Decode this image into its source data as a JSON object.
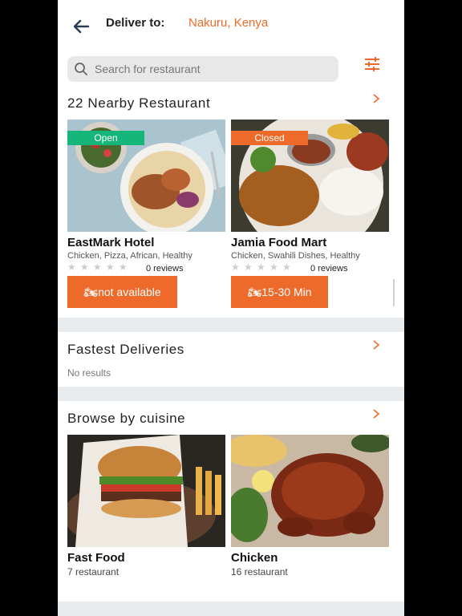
{
  "header": {
    "deliver_label": "Deliver to:",
    "location": "Nakuru, Kenya"
  },
  "search": {
    "placeholder": "Search for restaurant"
  },
  "nearby": {
    "title": "22 Nearby Restaurant",
    "cards": [
      {
        "status": "Open",
        "status_color": "#16b67a",
        "name": "EastMark Hotel",
        "categories": "Chicken, Pizza, African, Healthy",
        "reviews": "0 reviews",
        "order_label": "not available"
      },
      {
        "status": "Closed",
        "status_color": "#ee6a2a",
        "name": "Jamia Food Mart",
        "categories": "Chicken, Swahili Dishes, Healthy",
        "reviews": "0 reviews",
        "order_label": "15-30 Min"
      }
    ]
  },
  "fastest": {
    "title": "Fastest Deliveries",
    "empty_text": "No results"
  },
  "cuisine": {
    "title": "Browse by cuisine",
    "items": [
      {
        "name": "Fast Food",
        "count": "7 restaurant"
      },
      {
        "name": "Chicken",
        "count": "16 restaurant"
      }
    ]
  },
  "colors": {
    "accent": "#ee6a2a",
    "open": "#16b67a"
  }
}
